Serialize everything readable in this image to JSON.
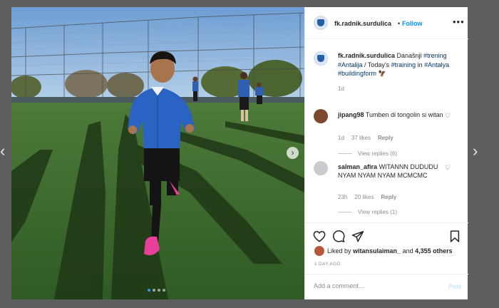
{
  "nav": {
    "prev_glyph": "‹",
    "next_glyph": "›"
  },
  "photo": {
    "next_glyph": "›",
    "slide_count": 4,
    "active_slide": 1
  },
  "header": {
    "username": "fk.radnik.surdulica",
    "separator": "•",
    "follow_label": "Follow",
    "more_glyph": "•••"
  },
  "caption": {
    "username": "fk.radnik.surdulica",
    "text_1": " Današnji ",
    "tag_1": "#trening",
    "tag_2": "#Antalija",
    "text_2": " / Today's ",
    "tag_3": "#training",
    "text_3": " in ",
    "tag_4": "#Antalya",
    "text_4": " ",
    "tag_5": "#buildingform",
    "emoji": "🦅",
    "time": "1d"
  },
  "comments": [
    {
      "username": "jipang98",
      "text": "Tumben di tongolin si witan",
      "time": "1d",
      "likes": "37 likes",
      "reply": "Reply",
      "view_replies": "View replies (6)"
    },
    {
      "username": "salman_afira",
      "text": "WITANNN DUDUDU NYAM NYAM NYAM MCMCMC",
      "time": "23h",
      "likes": "20 likes",
      "reply": "Reply",
      "view_replies": "View replies (1)"
    }
  ],
  "likes": {
    "prefix": "Liked by ",
    "user": "witansulaiman_",
    "middle": " and ",
    "count": "4,355 others"
  },
  "post_time": "1 DAY AGO",
  "add_comment": {
    "placeholder": "Add a comment...",
    "post_label": "Post"
  },
  "icons": [
    "chevron-left-icon",
    "chevron-right-icon",
    "heart-icon",
    "comment-icon",
    "share-icon",
    "bookmark-icon",
    "more-icon"
  ],
  "colors": {
    "accent": "#0095f6",
    "hashtag": "#00376b",
    "backdrop": "#5e5e5e",
    "meta_text": "#8e8e8e"
  }
}
